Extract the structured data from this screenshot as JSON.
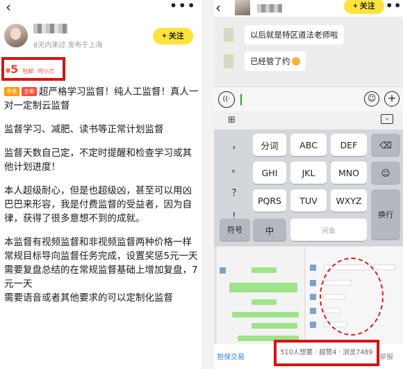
{
  "left": {
    "nav": {
      "back_icon": "‹",
      "more_icon": "•••"
    },
    "seller": {
      "meta": "8天内来过 发布于上海",
      "follow_label": "+ 关注"
    },
    "price": {
      "symbol": "¥",
      "amount": "5",
      "tag_shipping": "包邮",
      "tag_bargain": "可小刀"
    },
    "badges": {
      "first": "急售",
      "second": "全新"
    },
    "paragraphs": [
      "超严格学习监督！纯人工监督！真人一对一定制云监督",
      "监督学习、减肥、读书等正常计划监督",
      "监督天数自己定，不定时提醒和检查学习或其他计划进度！",
      "本人超级耐心，但是也超级凶，甚至可以用凶巴巴来形容，我是付费监督的受益者，因为自律，获得了很多意想不到的成就。",
      "本监督有视频监督和非视频监督两种价格一样\n常规目标导向监督任务完成，设置奖惩5元一天\n需要复盘总结的在常规监督基础上增加复盘，7元一天\n需要语音或者其他要求的可以定制化监督"
    ]
  },
  "right": {
    "nav": {
      "back_icon": "‹",
      "more_icon": "•••",
      "follow_label": "+ 关注"
    },
    "chat": [
      "以后就是特区道法老师啦",
      "已经管了约"
    ],
    "input": {
      "voice_icon": "((·",
      "emoji_icon": "☺",
      "plus_icon": "+"
    },
    "toolbar": {
      "grid_icon": "⊞",
      "hide_icon": "⌄"
    },
    "keyboard": {
      "left_col": [
        "，",
        "。",
        "？",
        "！"
      ],
      "row1": [
        "分词",
        "ABC",
        "DEF"
      ],
      "row2": [
        "GHI",
        "JKL",
        "MNO"
      ],
      "row3": [
        "PQRS",
        "TUV",
        "WXYZ"
      ],
      "backspace_icon": "⌫",
      "emoji_key_icon": "☺",
      "enter": "换行",
      "symbols": "符号",
      "zh": "中",
      "space_hint": "闲鱼"
    },
    "bottom": {
      "guarantee": "担保交易",
      "stats": "510人想要 · 超赞4 · 浏览7489",
      "report": "举报"
    }
  }
}
